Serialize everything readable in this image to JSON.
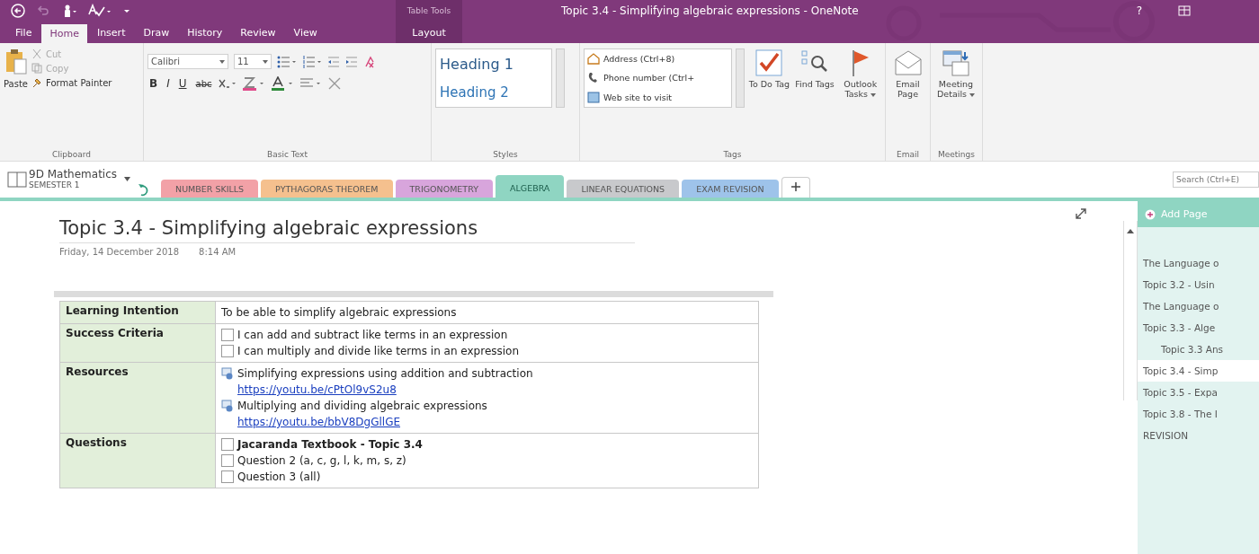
{
  "window": {
    "title": "Topic 3.4 - Simplifying algebraic expressions - OneNote",
    "contextual_label": "Table Tools",
    "help": "?"
  },
  "ribbon_tabs": [
    {
      "label": "File",
      "selected": false,
      "contextual": false
    },
    {
      "label": "Home",
      "selected": true,
      "contextual": false
    },
    {
      "label": "Insert",
      "selected": false,
      "contextual": false
    },
    {
      "label": "Draw",
      "selected": false,
      "contextual": false
    },
    {
      "label": "History",
      "selected": false,
      "contextual": false
    },
    {
      "label": "Review",
      "selected": false,
      "contextual": false
    },
    {
      "label": "View",
      "selected": false,
      "contextual": false
    },
    {
      "label": "Layout",
      "selected": false,
      "contextual": true
    }
  ],
  "clipboard": {
    "paste": "Paste",
    "items": [
      {
        "label": "Cut",
        "disabled": true
      },
      {
        "label": "Copy",
        "disabled": true
      },
      {
        "label": "Format Painter",
        "disabled": false
      }
    ],
    "group": "Clipboard"
  },
  "basic_text": {
    "font": "Calibri",
    "size": "11",
    "format_buttons": [
      "B",
      "I",
      "U",
      "abc"
    ],
    "group": "Basic Text"
  },
  "styles": {
    "items": [
      "Heading 1",
      "Heading 2"
    ],
    "group": "Styles"
  },
  "tags": {
    "items": [
      "Address (Ctrl+8)",
      "Phone number (Ctrl+",
      "Web site to visit"
    ],
    "buttons": [
      {
        "kind": "todo",
        "label": "To Do Tag",
        "dropdown": false
      },
      {
        "kind": "find",
        "label": "Find Tags",
        "dropdown": false
      },
      {
        "kind": "outlook",
        "label": "Outlook Tasks",
        "dropdown": true
      }
    ],
    "group": "Tags"
  },
  "email": {
    "label": "Email Page",
    "group": "Email"
  },
  "meetings": {
    "label": "Meeting Details",
    "dropdown": true,
    "group": "Meetings"
  },
  "notebook": {
    "name": "9D Mathematics",
    "section_group": "SEMESTER 1"
  },
  "sections": [
    {
      "label": "NUMBER SKILLS",
      "color": "#f2a1a7",
      "selected": false
    },
    {
      "label": "PYTHAGORAS THEOREM",
      "color": "#f5c08e",
      "selected": false
    },
    {
      "label": "TRIGONOMETRY",
      "color": "#d8a5dc",
      "selected": false
    },
    {
      "label": "ALGEBRA",
      "color": "#8fd5c2",
      "selected": true
    },
    {
      "label": "LINEAR EQUATIONS",
      "color": "#c8c9cc",
      "selected": false
    },
    {
      "label": "EXAM REVISION",
      "color": "#9ec3ea",
      "selected": false
    }
  ],
  "search": {
    "placeholder": "Search (Ctrl+E)"
  },
  "page": {
    "title": "Topic 3.4 - Simplifying algebraic expressions",
    "date": "Friday, 14 December 2018",
    "time": "8:14 AM",
    "table": [
      {
        "label": "Learning Intention",
        "items": [
          {
            "kind": "text",
            "text": "To be able to simplify algebraic expressions"
          }
        ]
      },
      {
        "label": "Success Criteria",
        "items": [
          {
            "kind": "check",
            "text": "I can add and subtract like terms in an expression",
            "checked": false,
            "bold": false
          },
          {
            "kind": "check",
            "text": "I can multiply and divide like terms in an expression",
            "checked": false,
            "bold": false
          }
        ]
      },
      {
        "label": "Resources",
        "items": [
          {
            "kind": "resource",
            "text": "Simplifying expressions using addition and subtraction"
          },
          {
            "kind": "link",
            "text": "https://youtu.be/cPtOl9vS2u8"
          },
          {
            "kind": "resource",
            "text": "Multiplying and dividing algebraic expressions"
          },
          {
            "kind": "link",
            "text": "https://youtu.be/bbV8DgGllGE"
          }
        ]
      },
      {
        "label": "Questions",
        "items": [
          {
            "kind": "check",
            "text": "Jacaranda Textbook - Topic 3.4",
            "checked": false,
            "bold": true
          },
          {
            "kind": "check",
            "text": "Question 2 (a, c, g, l, k, m, s, z)",
            "checked": false,
            "bold": false
          },
          {
            "kind": "check",
            "text": "Question 3 (all)",
            "checked": false,
            "bold": false
          }
        ]
      }
    ]
  },
  "pages_panel": {
    "add_page": "Add Page",
    "pages": [
      {
        "title": "The Language o",
        "selected": false
      },
      {
        "title": "Topic 3.2 - Usin",
        "selected": false
      },
      {
        "title": "The Language o",
        "selected": false
      },
      {
        "title": "Topic 3.3 - Alge",
        "selected": false,
        "children": [
          {
            "title": "Topic 3.3 Ans",
            "selected": false
          }
        ]
      },
      {
        "title": "Topic 3.4 - Simp",
        "selected": true
      },
      {
        "title": "Topic 3.5 - Expa",
        "selected": false
      },
      {
        "title": "Topic 3.8 - The I",
        "selected": false
      },
      {
        "title": "REVISION",
        "selected": false
      }
    ]
  }
}
